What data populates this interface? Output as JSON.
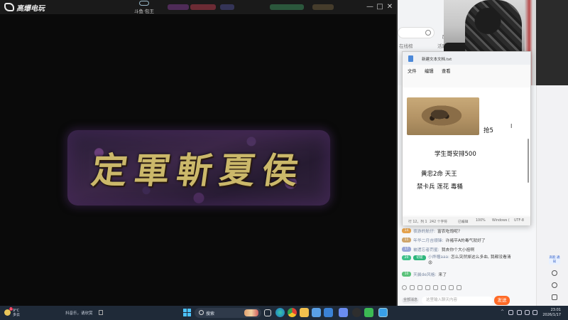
{
  "player": {
    "brand": "高爆电玩",
    "channel_tag": "斗鱼·包王",
    "title_card": "定軍斬夏侯",
    "window_controls": [
      "—",
      "□",
      "✕"
    ]
  },
  "live_panel": {
    "history_label": "历史",
    "tabs": [
      "在线榜",
      "活跃榜"
    ],
    "chat": [
      {
        "level": "14",
        "level_color": "#e6a34d",
        "name": "夜游的航仔:",
        "text": "富农吃饱呢?"
      },
      {
        "level": "11",
        "level_color": "#cfa56b",
        "name": "年华二月吉顺锋:",
        "text": "许褚平A的毒气就好了"
      },
      {
        "level": "17",
        "level_color": "#9aa7d8",
        "name": "被遗忘者罚星:",
        "text": "我去你个大小祖啊"
      },
      {
        "level": "20",
        "level_color": "#3fc08a",
        "badge": "初诞",
        "name": "小烨瞳aaa:",
        "text": "怎么突然掉这么多血, 我都没看清 😡"
      },
      {
        "level": "10",
        "level_color": "#5bc27b",
        "name": "天晨de风格:",
        "text": "来了"
      }
    ],
    "chat_chip": "全部消息",
    "input_placeholder": "这里输入聊天内容",
    "send_label": "发送",
    "strip_badge": "高能\n通知"
  },
  "notepad": {
    "title": "新建文本文档.txt",
    "menu": [
      "文件",
      "编辑",
      "查看"
    ],
    "lines": [
      "抢5",
      "学生哥安排500",
      "黄忠2命 天王",
      "禁卡兵 莲花 毒桶"
    ],
    "status": [
      "行 12，列 1",
      "242 个字符",
      "已编辑",
      "100%",
      "Windows (",
      "UTF-8"
    ]
  },
  "taskbar": {
    "weather_temp": "9°C",
    "weather_desc": "多云",
    "weather_alert": "1",
    "media_text": "抖音乐，请欣赏",
    "search_label": "搜索",
    "time": "23:01",
    "date": "2026/1/17"
  },
  "colors": {
    "accent": "#ff6a26",
    "title_gold": "#cbb86a",
    "taskbar": "#1f2a38"
  }
}
